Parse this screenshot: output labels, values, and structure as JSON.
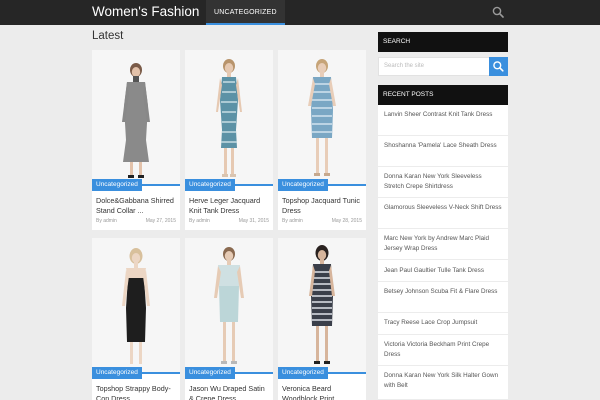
{
  "header": {
    "site_title": "Women's Fashion",
    "nav": [
      {
        "label": "UNCATEGORIZED",
        "active": true
      }
    ]
  },
  "main": {
    "heading": "Latest",
    "posts": [
      {
        "category": "Uncategorized",
        "title": "Dolce&Gabbana Shirred Stand Collar ...",
        "author": "By admin",
        "date": "May 27, 2015"
      },
      {
        "category": "Uncategorized",
        "title": "Herve Leger Jacquard Knit Tank Dress",
        "author": "By admin",
        "date": "May 31, 2015"
      },
      {
        "category": "Uncategorized",
        "title": "Topshop Jacquard Tunic Dress",
        "author": "By admin",
        "date": "May 28, 2015"
      },
      {
        "category": "Uncategorized",
        "title": "Topshop Strappy Body-Con Dress",
        "author": "",
        "date": ""
      },
      {
        "category": "Uncategorized",
        "title": "Jason Wu Draped Satin & Crepe Dress",
        "author": "",
        "date": ""
      },
      {
        "category": "Uncategorized",
        "title": "Veronica Beard Woodblock Print",
        "author": "",
        "date": ""
      }
    ]
  },
  "sidebar": {
    "search_title": "SEARCH",
    "search_placeholder": "Search the site",
    "recent_title": "RECENT POSTS",
    "recent_posts": [
      "Lanvin Sheer Contrast Knit Tank Dress",
      "Shoshanna 'Pamela' Lace Sheath Dress",
      "Donna Karan New York Sleeveless Stretch Crepe Shirtdress",
      "Glamorous Sleeveless V-Neck Shift Dress",
      "Marc New York by Andrew Marc Plaid Jersey Wrap Dress",
      "Jean Paul Gaultier Tulle Tank Dress",
      "Betsey Johnson Scuba Fit & Flare Dress",
      "Tracy Reese Lace Crop Jumpsuit",
      "Victoria Victoria Beckham Print Crepe Dress",
      "Donna Karan New York Silk Halter Gown with Belt"
    ]
  },
  "colors": {
    "accent": "#3a8fde",
    "topbar": "#262626",
    "widget_head": "#111111",
    "background": "#ececec"
  },
  "icons": {
    "search": "search-icon",
    "search_button": "search-icon"
  }
}
